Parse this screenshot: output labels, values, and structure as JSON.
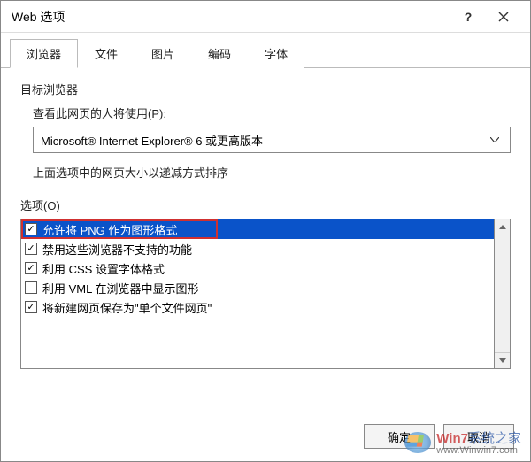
{
  "window": {
    "title": "Web 选项"
  },
  "tabs": [
    {
      "label": "浏览器",
      "active": true
    },
    {
      "label": "文件",
      "active": false
    },
    {
      "label": "图片",
      "active": false
    },
    {
      "label": "编码",
      "active": false
    },
    {
      "label": "字体",
      "active": false
    }
  ],
  "section": {
    "heading": "目标浏览器",
    "field_label": "查看此网页的人将使用(P):",
    "dropdown_value": "Microsoft® Internet Explorer® 6 或更高版本",
    "note": "上面选项中的网页大小以递减方式排序"
  },
  "options": {
    "label": "选项(O)",
    "items": [
      {
        "label": "允许将 PNG 作为图形格式",
        "checked": true,
        "selected": true,
        "highlighted": true
      },
      {
        "label": "禁用这些浏览器不支持的功能",
        "checked": true,
        "selected": false
      },
      {
        "label": "利用 CSS 设置字体格式",
        "checked": true,
        "selected": false
      },
      {
        "label": "利用 VML 在浏览器中显示图形",
        "checked": false,
        "selected": false
      },
      {
        "label": "将新建网页保存为\"单个文件网页\"",
        "checked": true,
        "selected": false
      }
    ]
  },
  "buttons": {
    "ok": "确定",
    "cancel": "取消"
  },
  "watermark": {
    "brand_prefix": "Win7",
    "brand_suffix": "系统之家",
    "url": "www.Winwin7.com"
  }
}
